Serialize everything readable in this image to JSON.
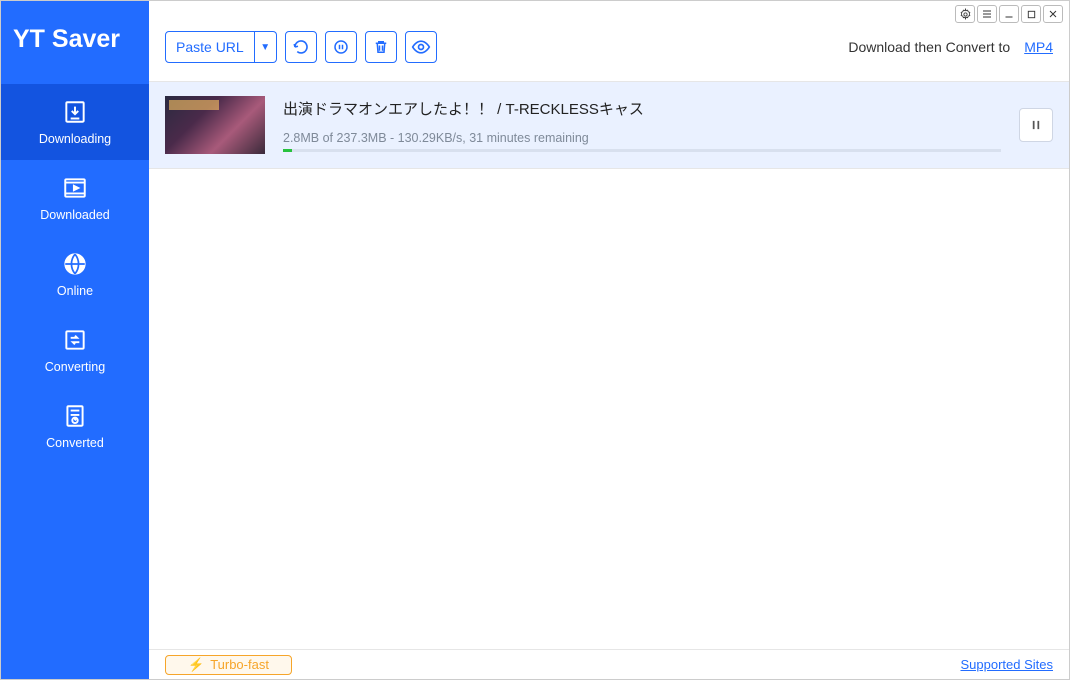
{
  "brand": "YT Saver",
  "sidebar": {
    "items": [
      {
        "label": "Downloading"
      },
      {
        "label": "Downloaded"
      },
      {
        "label": "Online"
      },
      {
        "label": "Converting"
      },
      {
        "label": "Converted"
      }
    ]
  },
  "toolbar": {
    "paste_label": "Paste URL",
    "convert_prefix": "Download then Convert to",
    "convert_format": "MP4"
  },
  "downloads": [
    {
      "title": "出演ドラマオンエアしたよ！！   / T-RECKLESSキャス",
      "status": "2.8MB of 237.3MB -  130.29KB/s, 31 minutes remaining",
      "progress_percent": 1.2
    }
  ],
  "footer": {
    "turbo_label": "Turbo-fast",
    "supported_label": "Supported Sites"
  }
}
